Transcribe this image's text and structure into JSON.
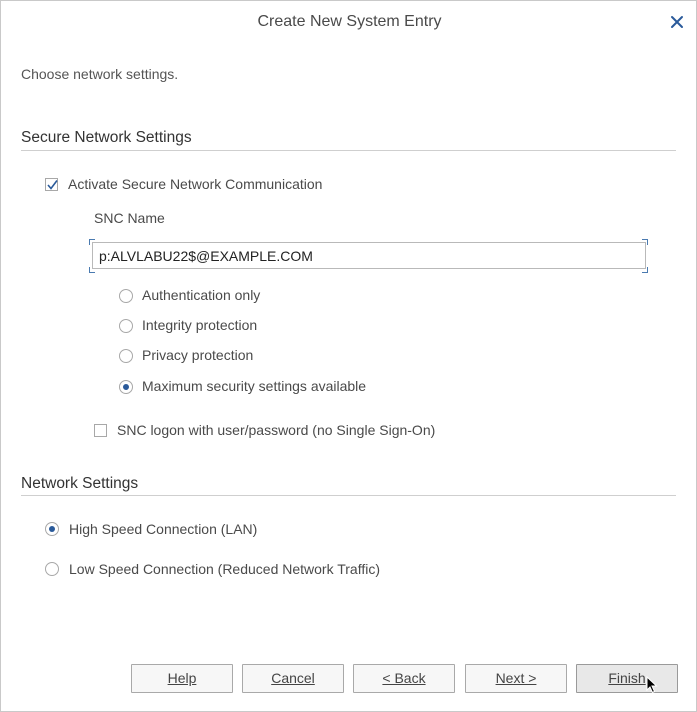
{
  "dialog": {
    "title": "Create New System Entry",
    "intro": "Choose network settings."
  },
  "secure_section": {
    "title": "Secure Network Settings",
    "activate_snc_label": "Activate Secure Network Communication",
    "activate_snc_checked": true,
    "snc_name_label": "SNC Name",
    "snc_name_value": "p:ALVLABU22$@EXAMPLE.COM",
    "protection_options": [
      {
        "label": "Authentication only",
        "selected": false
      },
      {
        "label": "Integrity protection",
        "selected": false
      },
      {
        "label": "Privacy protection",
        "selected": false
      },
      {
        "label": "Maximum security settings available",
        "selected": true
      }
    ],
    "snc_logon_label": "SNC logon with user/password (no Single Sign-On)",
    "snc_logon_checked": false
  },
  "network_section": {
    "title": "Network Settings",
    "options": [
      {
        "label": "High Speed Connection (LAN)",
        "selected": true
      },
      {
        "label": "Low Speed Connection (Reduced Network Traffic)",
        "selected": false
      }
    ]
  },
  "buttons": {
    "help": "Help",
    "cancel": "Cancel",
    "back": "< Back",
    "next": "Next >",
    "finish": "Finish"
  },
  "colors": {
    "accent": "#2a5a9a",
    "close_icon": "#2a5a9a"
  }
}
